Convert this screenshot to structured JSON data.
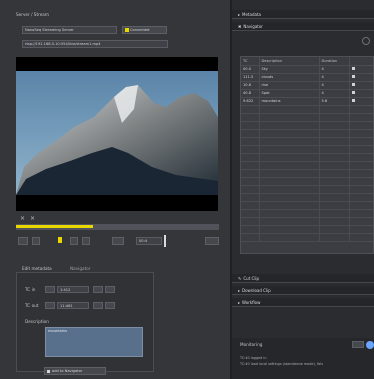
{
  "left": {
    "server_stream_label": "Server / Stream",
    "server_value": "NanoSeq Streaming Server",
    "connected_label": "Connected",
    "stream_path": "rtsp://192.168.0.10:554/live/stream1.mp4",
    "time_label": "00:4",
    "tabs": {
      "edit_label": "Edit metadata",
      "navigator_label": "Navigator"
    },
    "tc_in_label": "TC in",
    "tc_in_value": "1:412",
    "tc_out_label": "TC out",
    "tc_out_value": "11:461",
    "description_label": "Description",
    "description_value": "mountains",
    "add_button": "add to Navigator",
    "colors": {
      "progress": "#e9d800",
      "accent": "#6aa6ff"
    }
  },
  "right": {
    "metadata_label": "Metadata",
    "navigator_label": "Navigator",
    "table": {
      "headers": [
        "TC",
        "Description",
        "Duration",
        ""
      ],
      "rows": [
        [
          "00.0",
          "Sky",
          "4",
          ""
        ],
        [
          "111.5",
          "clouds",
          "4",
          ""
        ],
        [
          "10.6",
          "rise",
          "4",
          ""
        ],
        [
          "40.8",
          "Spot",
          "4",
          ""
        ],
        [
          "9.622",
          "mountains",
          "5.6",
          ""
        ]
      ]
    },
    "cut_clip_label": "Cut Clip",
    "download_clip_label": "Download Clip",
    "workflow_label": "Workflow",
    "monitoring_label": "Monitoring",
    "log_lines": [
      "TC:40 logged in",
      "TC:40 load local settings (standalone mode), fals"
    ]
  }
}
